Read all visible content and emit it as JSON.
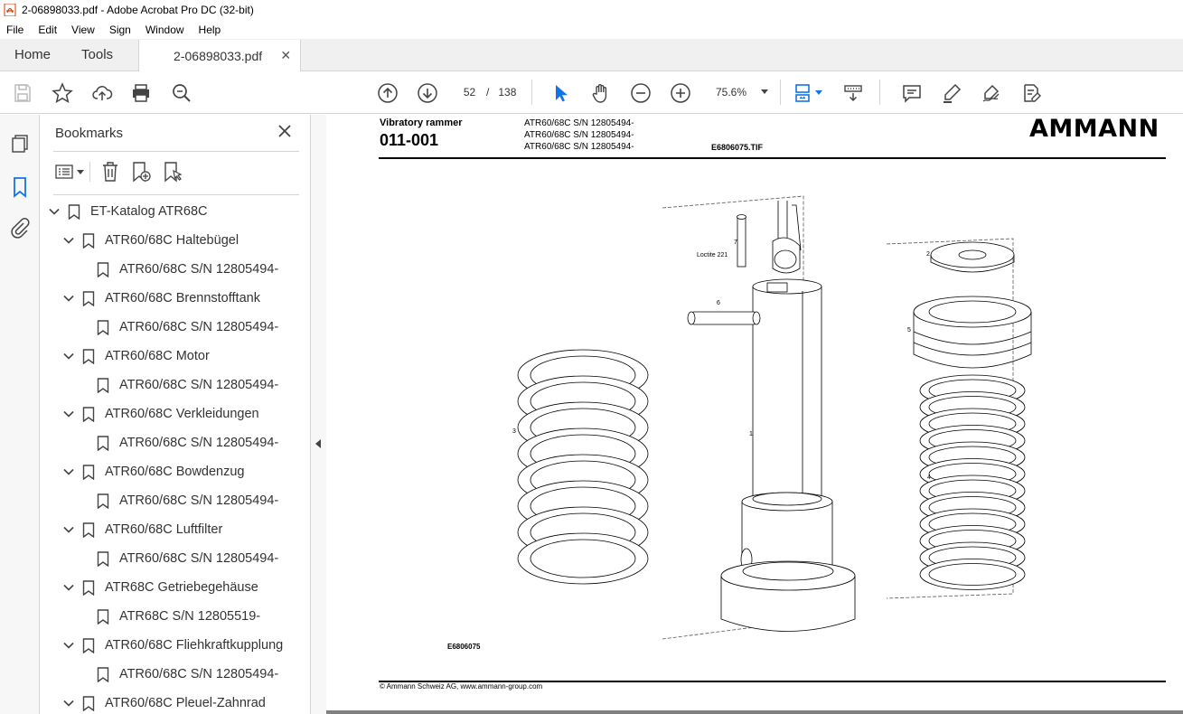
{
  "window": {
    "title": "2-06898033.pdf - Adobe Acrobat Pro DC (32-bit)"
  },
  "menu": [
    "File",
    "Edit",
    "View",
    "Sign",
    "Window",
    "Help"
  ],
  "tabs": {
    "home": "Home",
    "tools": "Tools",
    "document": "2-06898033.pdf"
  },
  "toolbar": {
    "current_page": "52",
    "page_separator": "/",
    "total_pages": "138",
    "zoom": "75.6%"
  },
  "bookmarks": {
    "title": "Bookmarks",
    "items": [
      {
        "label": "ET-Katalog ATR68C",
        "level": 0,
        "expanded": true
      },
      {
        "label": "ATR60/68C Haltebügel",
        "level": 1,
        "expanded": true
      },
      {
        "label": "ATR60/68C S/N 12805494-",
        "level": 2
      },
      {
        "label": "ATR60/68C Brennstofftank",
        "level": 1,
        "expanded": true
      },
      {
        "label": "ATR60/68C S/N 12805494-",
        "level": 2
      },
      {
        "label": "ATR60/68C Motor",
        "level": 1,
        "expanded": true
      },
      {
        "label": "ATR60/68C S/N 12805494-",
        "level": 2
      },
      {
        "label": "ATR60/68C Verkleidungen",
        "level": 1,
        "expanded": true
      },
      {
        "label": "ATR60/68C S/N 12805494-",
        "level": 2
      },
      {
        "label": "ATR60/68C Bowdenzug",
        "level": 1,
        "expanded": true
      },
      {
        "label": "ATR60/68C S/N 12805494-",
        "level": 2
      },
      {
        "label": "ATR60/68C Luftfilter",
        "level": 1,
        "expanded": true
      },
      {
        "label": "ATR60/68C S/N 12805494-",
        "level": 2
      },
      {
        "label": "ATR68C Getriebegehäuse",
        "level": 1,
        "expanded": true
      },
      {
        "label": "ATR68C S/N 12805519-",
        "level": 2
      },
      {
        "label": "ATR60/68C Fliehkraftkupplung",
        "level": 1,
        "expanded": true
      },
      {
        "label": "ATR60/68C S/N 12805494-",
        "level": 2
      },
      {
        "label": "ATR60/68C Pleuel-Zahnrad",
        "level": 1,
        "expanded": true
      }
    ]
  },
  "page": {
    "header_title": "Vibratory rammer",
    "header_number": "011-001",
    "serials": [
      "ATR60/68C S/N 12805494-",
      "ATR60/68C S/N 12805494-",
      "ATR60/68C S/N 12805494-"
    ],
    "tif_name": "E6806075.TIF",
    "logo": "AMMANN",
    "figure_id": "E6806075",
    "footer": "© Ammann Schweiz AG, www.ammann-group.com",
    "part_labels": {
      "p1": "1",
      "p2": "2",
      "p3": "3",
      "p4": "4",
      "p5": "5",
      "p6": "6",
      "p7": "7",
      "loctite": "Loctite 221"
    }
  },
  "colors": {
    "accent": "#1473e6",
    "chrome": "#f0f0f0",
    "border": "#d4d4d4"
  }
}
